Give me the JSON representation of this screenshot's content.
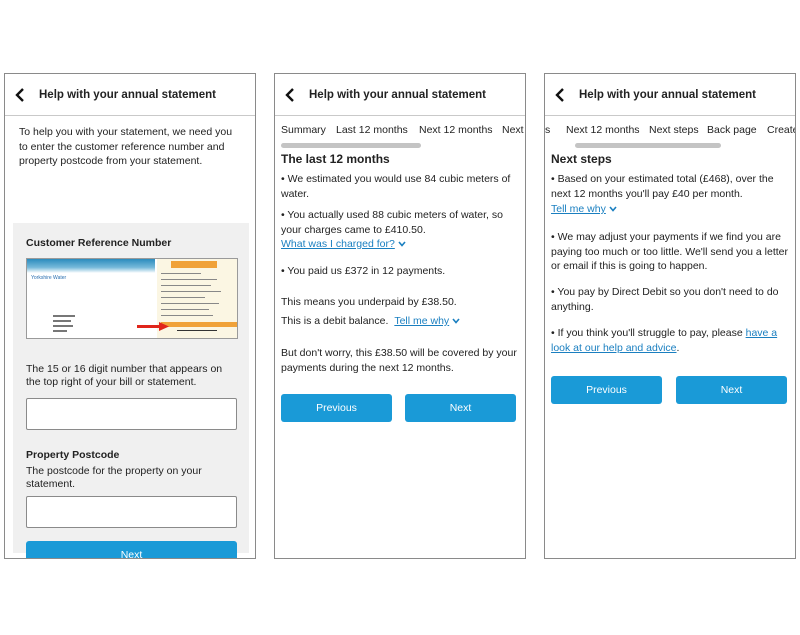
{
  "colors": {
    "primary": "#1a9ad7",
    "link": "#1a7fc0",
    "panel": "#f0f0f0"
  },
  "screen1": {
    "title": "Help with your annual statement",
    "intro": "To help you with your statement, we need you to enter the customer reference number and property postcode from your statement.",
    "ref_label": "Customer Reference Number",
    "bill_logo": "Yorkshire Water",
    "ref_help": "The 15 or 16 digit number that appears on the top right of your bill or statement.",
    "postcode_label": "Property Postcode",
    "postcode_help": "The postcode for the property on your statement.",
    "next": "Next"
  },
  "screen2": {
    "title": "Help with your annual statement",
    "tabs": [
      "Summary",
      "Last 12 months",
      "Next 12 months",
      "Next"
    ],
    "section_title": "The last 12 months",
    "p1": "• We estimated you would use 84 cubic meters of water.",
    "p2": "• You actually used 88 cubic meters of water, so your charges came to £410.50.",
    "link1": "What was I charged for?",
    "p3": "• You paid us £372 in 12 payments.",
    "p4": "This means you underpaid by £38.50.",
    "p5": "This is a debit balance.",
    "link2": "Tell me why",
    "p6": "But don't worry, this £38.50 will be covered by your payments during the next 12 months.",
    "prev": "Previous",
    "next": "Next"
  },
  "screen3": {
    "title": "Help with your annual statement",
    "tabs": [
      "s",
      "Next 12 months",
      "Next steps",
      "Back page",
      "Create"
    ],
    "section_title": "Next steps",
    "p1": "• Based on your estimated total (£468), over the next 12 months you'll pay £40 per month.",
    "link1": "Tell me why",
    "p2": "• We may adjust your payments if we find you are paying too much or too little. We'll send you a letter or email if this is going to happen.",
    "p3": "• You pay by Direct Debit so you don't need to do anything.",
    "p4": "• If you think you'll struggle to pay, please",
    "link2": "have a look at our help and advice",
    "p4_end": ".",
    "prev": "Previous",
    "next": "Next"
  }
}
